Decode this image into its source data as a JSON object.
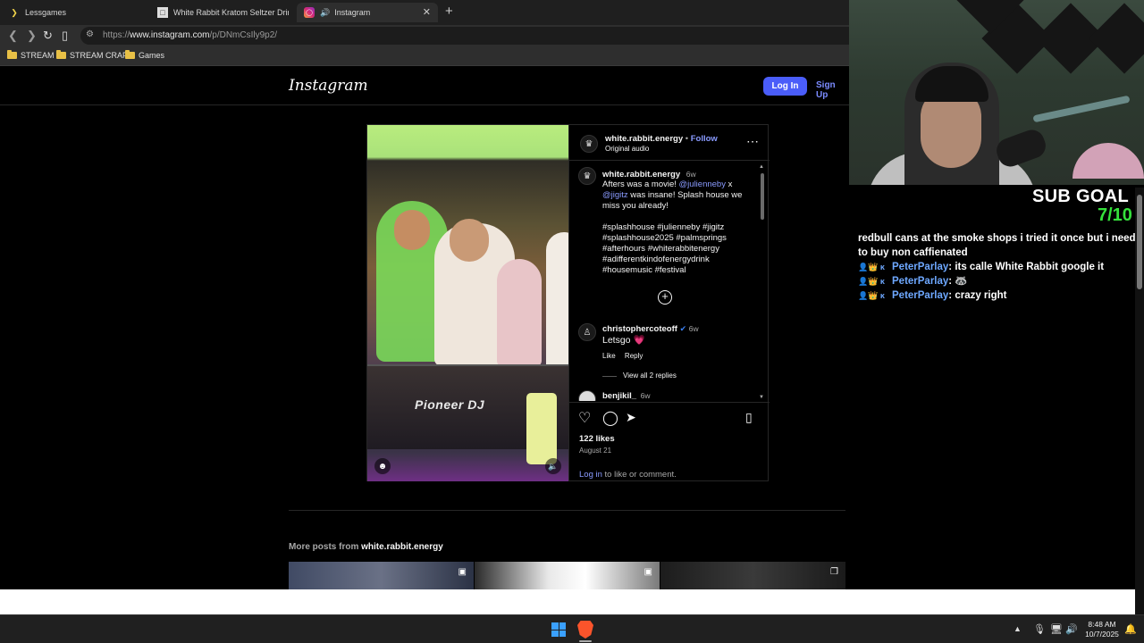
{
  "browser": {
    "tabs": [
      {
        "title": "Lessgames",
        "active": false
      },
      {
        "title": "White Rabbit Kratom Seltzer Drinks:",
        "active": false
      },
      {
        "title": "Instagram",
        "active": true
      }
    ],
    "url_prefix": "https://",
    "url_host": "www.instagram.com",
    "url_path": "/p/DNmCsIly9p2/",
    "bookmarks": [
      "STREAM",
      "STREAM CRAP",
      "Games"
    ]
  },
  "instagram": {
    "logo": "Instagram",
    "login_label": "Log In",
    "signup_label": "Sign Up",
    "post": {
      "author": "white.rabbit.energy",
      "follow_separator": "•",
      "follow_label": "Follow",
      "audio": "Original audio",
      "media_brand_text": "Pioneer DJ",
      "caption": {
        "author": "white.rabbit.energy",
        "age": "6w",
        "text_1": "Afters was a movie! ",
        "mention_1": "@julienneby",
        "text_2": " x ",
        "mention_2": "@jigitz",
        "text_3": " was insane! Splash house we miss you already!",
        "hashtags": "#splashhouse #julienneby #jigitz #splashhouse2025 #palmsprings #afterhours #whiterabbitenergy #adifferentkindofenergydrink #housemusic #festival"
      },
      "comments": [
        {
          "author": "christophercoteoff",
          "age": "6w",
          "text": "Letsgo 💗",
          "like": "Like",
          "reply": "Reply",
          "view_replies": "View all 2 replies"
        },
        {
          "author": "benjikil_",
          "age": "6w"
        }
      ],
      "likes": "122 likes",
      "date": "August 21",
      "login_prompt_link": "Log in",
      "login_prompt_text": " to like or comment."
    },
    "more_posts_prefix": "More posts from ",
    "more_posts_user": "white.rabbit.energy"
  },
  "taskbar": {
    "time": "8:48 AM",
    "date": "10/7/2025"
  },
  "stream": {
    "sub_goal_label": "SUB GOAL",
    "sub_goal_count": "7/10",
    "chat": [
      {
        "name": "",
        "message": "redbull cans at the smoke shops i tried it once but i need to buy non caffienated"
      },
      {
        "name": "PeterParlay",
        "message": ": its calle White Rabbit google it"
      },
      {
        "name": "PeterParlay",
        "message": ": 🦝"
      },
      {
        "name": "PeterParlay",
        "message": ": crazy right"
      }
    ]
  },
  "colors": {
    "accent": "#4a5df9",
    "link": "#8a9bff",
    "sub_count": "#35e03b",
    "chat_name": "#6ea8ff"
  }
}
